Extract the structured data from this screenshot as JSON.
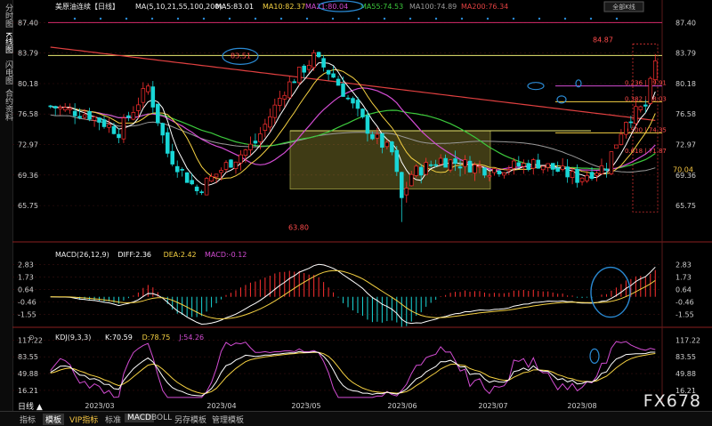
{
  "sidebar_tabs": [
    "分时图",
    "K线图",
    "闪电图",
    "合约资料"
  ],
  "main_header": {
    "instrument": "美原油连续",
    "period": "日线",
    "ma_params": "MA(5,10,21,55,100,200)",
    "items": [
      {
        "label": "MA5:83.01",
        "color": "#ffffff"
      },
      {
        "label": "MA10:82.37",
        "color": "#f5d142"
      },
      {
        "label": "MA21:80.04",
        "color": "#d24cd2"
      },
      {
        "label": "MA55:74.53",
        "color": "#3cc83c"
      },
      {
        "label": "MA100:74.89",
        "color": "#9a9a9a"
      },
      {
        "label": "MA200:76.34",
        "color": "#e04040"
      }
    ],
    "toggle_label": "全部K线"
  },
  "macd_header": {
    "name": "MACD(26,12,9)",
    "items": [
      {
        "label": "DIFF:2.36",
        "color": "#ffffff"
      },
      {
        "label": "DEA:2.42",
        "color": "#f5d142"
      },
      {
        "label": "MACD:-0.12",
        "color": "#d24cd2"
      }
    ]
  },
  "kdj_header": {
    "name": "KDJ(9,3,3)",
    "items": [
      {
        "label": "K:70.59",
        "color": "#ffffff"
      },
      {
        "label": "D:78.75",
        "color": "#f5d142"
      },
      {
        "label": "J:54.26",
        "color": "#d24cd2"
      }
    ]
  },
  "chart_data": [
    {
      "type": "candlestick",
      "yaxis_ticks": [
        "87.40",
        "83.79",
        "80.18",
        "76.58",
        "72.97",
        "69.36",
        "65.75"
      ],
      "yaxis_values": [
        87.4,
        83.79,
        80.18,
        76.58,
        72.97,
        69.36,
        65.75
      ],
      "ylim": [
        62.5,
        88.6
      ],
      "x_dates": [
        "2023/03",
        "2023/04",
        "2023/05",
        "2023/06",
        "2023/07",
        "2023/08"
      ],
      "annotations": [
        {
          "text": "83.51",
          "value": 83.51
        },
        {
          "text": "84.87",
          "value": 84.87
        },
        {
          "text": "63.80",
          "value": 63.8
        },
        {
          "text": "70.04",
          "value": 70.04
        }
      ],
      "fibonacci": [
        {
          "label": "0.236 | 79.91",
          "value": 79.91
        },
        {
          "label": "0.382 | 78.03",
          "value": 78.03
        },
        {
          "label": "0.500 | 74.35",
          "value": 74.35
        },
        {
          "label": "0.618 | 71.87",
          "value": 71.87
        }
      ],
      "resistance_value": 83.51,
      "top_line_value": 87.4,
      "range_box": {
        "low": 67.7,
        "high": 74.6
      }
    },
    {
      "type": "line",
      "name": "MACD",
      "yaxis_ticks": [
        "2.83",
        "1.73",
        "0.64",
        "-0.46",
        "-1.55"
      ],
      "yaxis_values": [
        2.83,
        1.73,
        0.64,
        -0.46,
        -1.55
      ],
      "ylim": [
        -2.2,
        3.4
      ]
    },
    {
      "type": "line",
      "name": "KDJ",
      "yaxis_ticks": [
        "117.22",
        "83.55",
        "49.88",
        "16.21"
      ],
      "yaxis_values": [
        117.22,
        83.55,
        49.88,
        16.21
      ],
      "ylim": [
        0,
        125
      ]
    }
  ],
  "bottom_tabs": [
    "指标",
    "模板",
    "VIP指标",
    "标准",
    "MACD",
    "BOLL",
    "另存模板",
    "管理模板"
  ],
  "period_label": "日线 ▲",
  "brand": "FX678"
}
